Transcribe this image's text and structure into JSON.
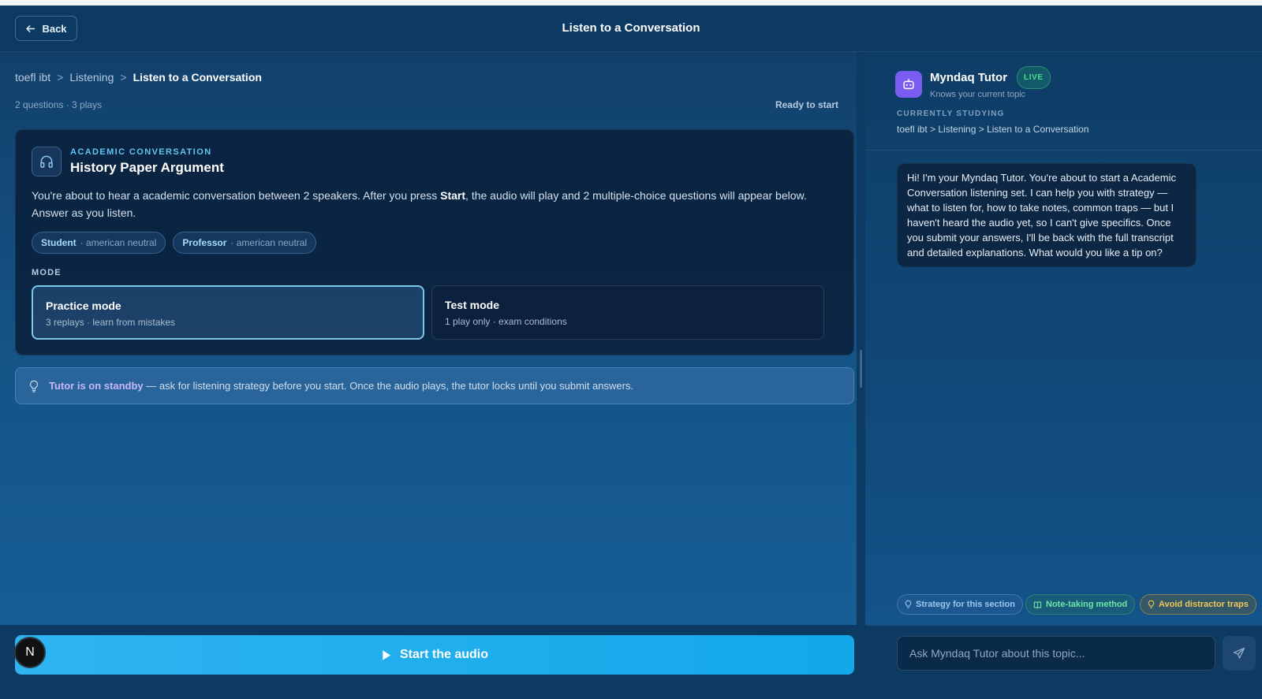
{
  "header": {
    "back_label": "Back",
    "title": "Listen to a Conversation"
  },
  "breadcrumb": {
    "items": [
      "toefl ibt",
      "Listening",
      "Listen to a Conversation"
    ],
    "separator": ">"
  },
  "meta": {
    "counts": "2 questions · 3 plays",
    "status": "Ready to start"
  },
  "card": {
    "icon": "headphones-icon",
    "eyebrow": "ACADEMIC CONVERSATION",
    "title": "History Paper Argument",
    "desc_before": "You're about to hear a academic conversation between 2 speakers. After you press ",
    "desc_strong": "Start",
    "desc_after": ", the audio will play and 2 multiple-choice questions will appear below. Answer as you listen.",
    "speakers": [
      {
        "role": "Student",
        "accent": "· american neutral"
      },
      {
        "role": "Professor",
        "accent": "· american neutral"
      }
    ],
    "mode_label": "MODE",
    "modes": [
      {
        "name": "Practice mode",
        "sub": "3 replays · learn from mistakes",
        "selected": true
      },
      {
        "name": "Test mode",
        "sub": "1 play only · exam conditions",
        "selected": false
      }
    ]
  },
  "tip": {
    "icon": "lightbulb-icon",
    "strong": "Tutor is on standby",
    "text": " — ask for listening strategy before you start. Once the audio plays, the tutor locks until you submit answers."
  },
  "start_button": {
    "icon": "play-icon",
    "label": "Start the audio"
  },
  "user_avatar": {
    "initial": "N"
  },
  "tutor": {
    "name": "Myndaq Tutor",
    "badge": "LIVE",
    "subtitle": "Knows your current topic",
    "studying_label": "CURRENTLY STUDYING",
    "studying_path": "toefl ibt > Listening > Listen to a Conversation",
    "message": "Hi! I'm your Myndaq Tutor. You're about to start a Academic Conversation listening set. I can help you with strategy — what to listen for, how to take notes, common traps — but I haven't heard the audio yet, so I can't give specifics. Once you submit your answers, I'll be back with the full transcript and detailed explanations. What would you like a tip on?",
    "quick_actions": [
      {
        "label": "Strategy for this section",
        "icon": "lightbulb-icon"
      },
      {
        "label": "Note-taking method",
        "icon": "book-icon"
      },
      {
        "label": "Avoid distractor traps",
        "icon": "lightbulb-icon"
      }
    ],
    "input_placeholder": "Ask Myndaq Tutor about this topic...",
    "send_icon": "send-icon"
  },
  "colors": {
    "accent": "#12a8ea",
    "eyebrow": "#5fc6f2",
    "tutor_avatar": "#7b5cf0",
    "live": "#46e08a",
    "strategy": "#9cc6f0",
    "notes": "#6ee6a2",
    "traps": "#f0c75a"
  }
}
